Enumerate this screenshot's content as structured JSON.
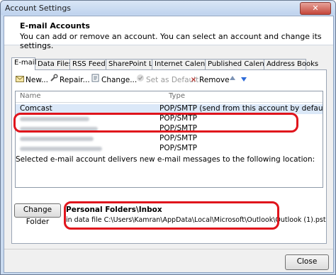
{
  "window": {
    "title": "Account Settings",
    "close_glyph": "✕"
  },
  "header": {
    "title": "E-mail Accounts",
    "description": "You can add or remove an account. You can select an account and change its settings."
  },
  "tabs": [
    {
      "label": "E-mail",
      "active": true
    },
    {
      "label": "Data Files"
    },
    {
      "label": "RSS Feeds"
    },
    {
      "label": "SharePoint Lists"
    },
    {
      "label": "Internet Calendars"
    },
    {
      "label": "Published Calendars"
    },
    {
      "label": "Address Books"
    }
  ],
  "toolbar": {
    "new_label": "New...",
    "repair_label": "Repair...",
    "change_label": "Change...",
    "set_default_label": "Set as Default",
    "remove_label": "Remove"
  },
  "accounts": {
    "columns": {
      "name": "Name",
      "type": "Type"
    },
    "rows": [
      {
        "name": "Comcast",
        "type": "POP/SMTP (send from this account by default)",
        "selected": true
      },
      {
        "name": "",
        "type": "POP/SMTP"
      },
      {
        "name": "",
        "type": "POP/SMTP"
      },
      {
        "name": "",
        "type": "POP/SMTP"
      },
      {
        "name": "",
        "type": "POP/SMTP"
      }
    ]
  },
  "delivery": {
    "description": "Selected e-mail account delivers new e-mail messages to the following location:",
    "change_folder_label": "Change Folder",
    "folder": "Personal Folders\\Inbox",
    "path": "in data file C:\\Users\\Kamran\\AppData\\Local\\Microsoft\\Outlook\\Outlook (1).pst"
  },
  "footer": {
    "close_label": "Close"
  },
  "colors": {
    "annotation_red": "#e0141c",
    "selection": "#dbe8f8",
    "frame": "#c9daf0"
  },
  "icons": {
    "new": "new-mail-icon",
    "repair": "repair-icon",
    "change": "change-icon",
    "set_default": "checkmark-icon",
    "remove": "remove-x-icon",
    "move_up": "arrow-up-icon",
    "move_down": "arrow-down-icon"
  }
}
